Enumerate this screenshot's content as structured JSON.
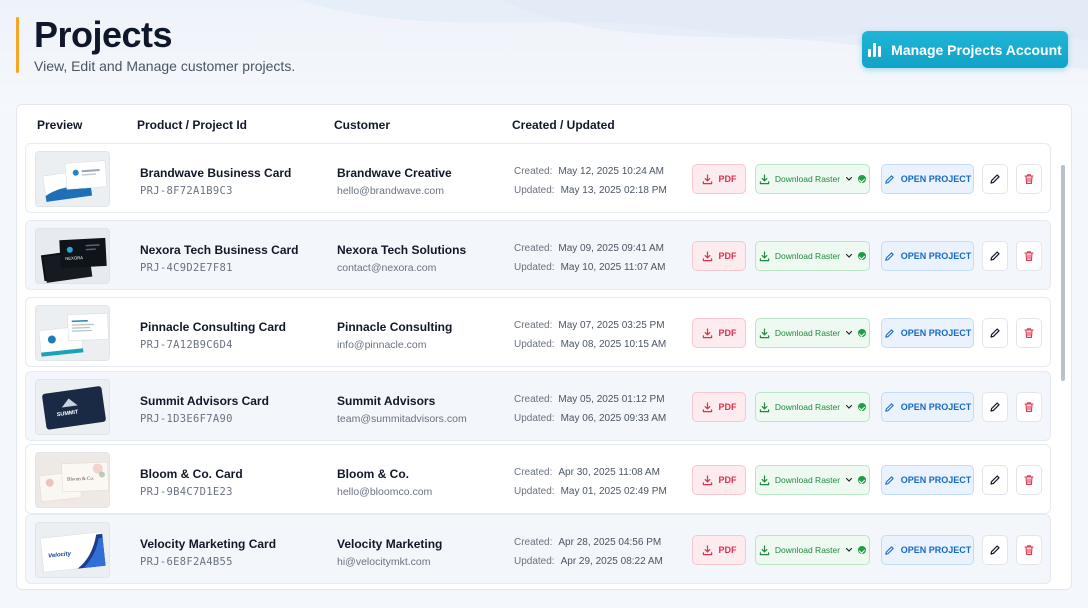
{
  "header": {
    "title": "Projects",
    "subtitle": "View, Edit and Manage customer projects.",
    "manage_button": "Manage Projects Account"
  },
  "table": {
    "columns": [
      "Preview",
      "Product / Project Id",
      "Customer",
      "Created / Updated"
    ],
    "created_label": "Created:",
    "updated_label": "Updated:",
    "pdf_label": "PDF",
    "raster_label": "Download Raster",
    "open_label": "OPEN PROJECT",
    "rows": [
      {
        "product": "Brandwave Business Card",
        "id": "PRJ-8F72A1B9C3",
        "customer": "Brandwave Creative",
        "email": "hello@brandwave.com",
        "created": "May 12, 2025 10:24 AM",
        "updated": "May 13, 2025 02:18 PM"
      },
      {
        "product": "Nexora Tech Business Card",
        "id": "PRJ-4C9D2E7F81",
        "customer": "Nexora Tech Solutions",
        "email": "contact@nexora.com",
        "created": "May 09, 2025 09:41 AM",
        "updated": "May 10, 2025 11:07 AM"
      },
      {
        "product": "Pinnacle Consulting Card",
        "id": "PRJ-7A12B9C6D4",
        "customer": "Pinnacle Consulting",
        "email": "info@pinnacle.com",
        "created": "May 07, 2025 03:25 PM",
        "updated": "May 08, 2025 10:15 AM"
      },
      {
        "product": "Summit Advisors Card",
        "id": "PRJ-1D3E6F7A90",
        "customer": "Summit Advisors",
        "email": "team@summitadvisors.com",
        "created": "May 05, 2025 01:12 PM",
        "updated": "May 06, 2025 09:33 AM"
      },
      {
        "product": "Bloom & Co. Card",
        "id": "PRJ-9B4C7D1E23",
        "customer": "Bloom & Co.",
        "email": "hello@bloomco.com",
        "created": "Apr 30, 2025 11:08 AM",
        "updated": "May 01, 2025 02:49 PM"
      },
      {
        "product": "Velocity Marketing Card",
        "id": "PRJ-6E8F2A4B55",
        "customer": "Velocity Marketing",
        "email": "hi@velocitymkt.com",
        "created": "Apr 28, 2025 04:56 PM",
        "updated": "Apr 29, 2025 08:22 AM"
      }
    ]
  },
  "thumbnails": {
    "nexora_logo": "NEXORA",
    "summit_logo": "SUMMIT",
    "bloom_logo": "Bloom & Co.",
    "velocity_logo": "Velocity"
  },
  "colors": {
    "accent": "#f5a623",
    "primary": "#12a3c6",
    "pdf": "#dc2f4a",
    "raster": "#1f8a3d",
    "open": "#1769c4"
  }
}
